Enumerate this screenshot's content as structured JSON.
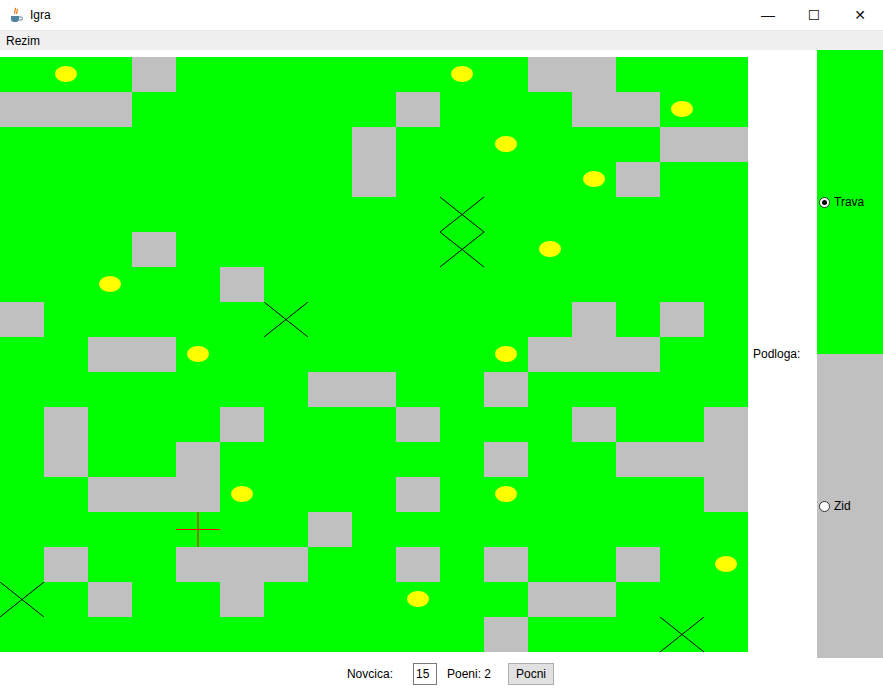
{
  "window": {
    "title": "Igra",
    "controls": [
      "—",
      "☐",
      "✕"
    ]
  },
  "menu": [
    "Rezim"
  ],
  "board": {
    "rows": [
      [
        "grass",
        "coin",
        "grass",
        "wall",
        "grass",
        "grass",
        "grass",
        "grass",
        "grass",
        "grass",
        "coin",
        "grass",
        "wall",
        "wall",
        "grass",
        "grass",
        "grass"
      ],
      [
        "wall",
        "wall",
        "wall",
        "grass",
        "grass",
        "grass",
        "grass",
        "grass",
        "grass",
        "wall",
        "grass",
        "grass",
        "grass",
        "wall",
        "wall",
        "coin",
        "grass"
      ],
      [
        "grass",
        "grass",
        "grass",
        "grass",
        "grass",
        "grass",
        "grass",
        "grass",
        "wall",
        "grass",
        "grass",
        "coin",
        "grass",
        "grass",
        "grass",
        "wall",
        "wall"
      ],
      [
        "grass",
        "grass",
        "grass",
        "grass",
        "grass",
        "grass",
        "grass",
        "grass",
        "wall",
        "grass",
        "grass",
        "grass",
        "grass",
        "coin",
        "wall",
        "grass",
        "grass"
      ],
      [
        "grass",
        "grass",
        "grass",
        "grass",
        "grass",
        "grass",
        "grass",
        "grass",
        "grass",
        "grass",
        "enemy",
        "grass",
        "grass",
        "grass",
        "grass",
        "grass",
        "grass"
      ],
      [
        "grass",
        "grass",
        "grass",
        "wall",
        "grass",
        "grass",
        "grass",
        "grass",
        "grass",
        "grass",
        "enemy",
        "grass",
        "coin",
        "grass",
        "grass",
        "grass",
        "grass"
      ],
      [
        "grass",
        "grass",
        "coin",
        "grass",
        "grass",
        "wall",
        "grass",
        "grass",
        "grass",
        "grass",
        "grass",
        "grass",
        "grass",
        "grass",
        "grass",
        "grass",
        "grass"
      ],
      [
        "wall",
        "grass",
        "grass",
        "grass",
        "grass",
        "grass",
        "enemy",
        "grass",
        "grass",
        "grass",
        "grass",
        "grass",
        "grass",
        "wall",
        "grass",
        "wall",
        "grass"
      ],
      [
        "grass",
        "grass",
        "wall",
        "wall",
        "coin",
        "grass",
        "grass",
        "grass",
        "grass",
        "grass",
        "grass",
        "coin",
        "wall",
        "wall",
        "wall",
        "grass",
        "grass"
      ],
      [
        "grass",
        "grass",
        "grass",
        "grass",
        "grass",
        "grass",
        "grass",
        "wall",
        "wall",
        "grass",
        "grass",
        "wall",
        "grass",
        "grass",
        "grass",
        "grass",
        "grass"
      ],
      [
        "grass",
        "wall",
        "grass",
        "grass",
        "grass",
        "wall",
        "grass",
        "grass",
        "grass",
        "wall",
        "grass",
        "grass",
        "grass",
        "wall",
        "grass",
        "grass",
        "wall"
      ],
      [
        "grass",
        "wall",
        "grass",
        "grass",
        "wall",
        "grass",
        "grass",
        "grass",
        "grass",
        "grass",
        "grass",
        "wall",
        "grass",
        "grass",
        "wall",
        "wall",
        "wall"
      ],
      [
        "grass",
        "grass",
        "wall",
        "wall",
        "wall",
        "coin",
        "grass",
        "grass",
        "grass",
        "wall",
        "grass",
        "coin",
        "grass",
        "grass",
        "grass",
        "grass",
        "wall"
      ],
      [
        "grass",
        "grass",
        "grass",
        "grass",
        "player",
        "grass",
        "grass",
        "wall",
        "grass",
        "grass",
        "grass",
        "grass",
        "grass",
        "grass",
        "grass",
        "grass",
        "grass"
      ],
      [
        "grass",
        "wall",
        "grass",
        "grass",
        "wall",
        "wall",
        "wall",
        "grass",
        "grass",
        "wall",
        "grass",
        "wall",
        "grass",
        "grass",
        "wall",
        "grass",
        "coin"
      ],
      [
        "enemy",
        "grass",
        "wall",
        "grass",
        "grass",
        "wall",
        "grass",
        "grass",
        "grass",
        "coin",
        "grass",
        "grass",
        "wall",
        "wall",
        "grass",
        "grass",
        "grass"
      ],
      [
        "grass",
        "grass",
        "grass",
        "grass",
        "grass",
        "grass",
        "grass",
        "grass",
        "grass",
        "grass",
        "grass",
        "wall",
        "grass",
        "grass",
        "grass",
        "enemy",
        "grass"
      ]
    ]
  },
  "floor": {
    "label": "Podloga:",
    "options": [
      {
        "label": "Trava",
        "selected": true,
        "color": "#00ff00"
      },
      {
        "label": "Zid",
        "selected": false,
        "color": "#c0c0c0"
      }
    ]
  },
  "bottom": {
    "coins_label": "Novcica:",
    "coins_value": "15",
    "points": "Poeni: 2",
    "button": "Pocni"
  }
}
